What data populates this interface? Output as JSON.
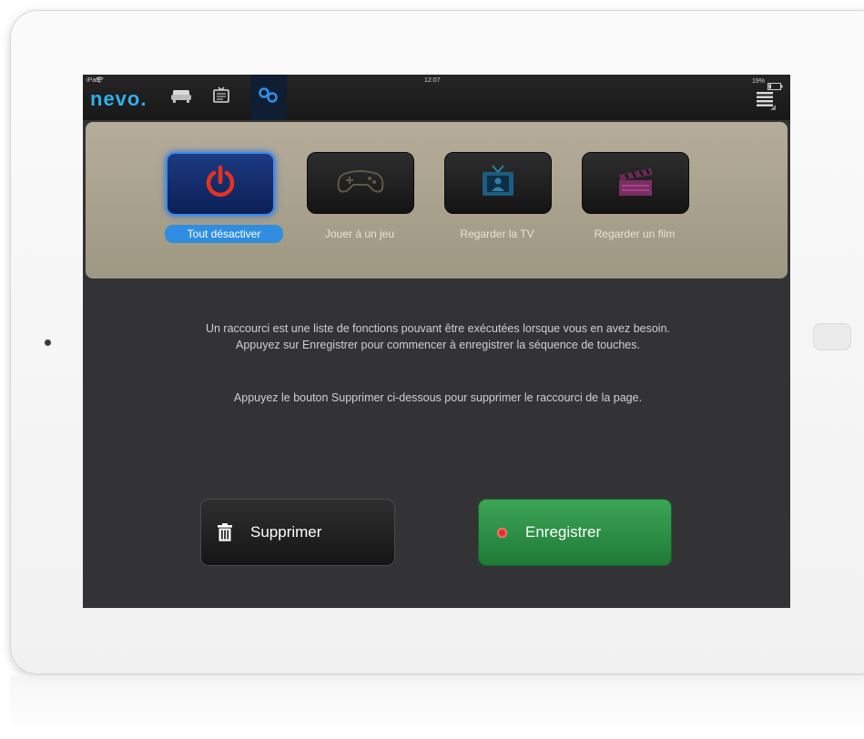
{
  "status_bar": {
    "device": "iPad",
    "time": "12:07",
    "battery": "19%"
  },
  "app": {
    "logo": "nevo."
  },
  "nav": [
    {
      "icon": "sofa-icon",
      "active": false
    },
    {
      "icon": "tv-guide-icon",
      "active": false
    },
    {
      "icon": "shortcut-icon",
      "active": true
    }
  ],
  "activities": [
    {
      "label": "Tout désactiver",
      "icon": "power-icon",
      "selected": true
    },
    {
      "label": "Jouer à un jeu",
      "icon": "gamepad-icon",
      "selected": false
    },
    {
      "label": "Regarder la TV",
      "icon": "tv-icon",
      "selected": false
    },
    {
      "label": "Regarder un film",
      "icon": "clapperboard-icon",
      "selected": false
    }
  ],
  "message": {
    "line1": "Un raccourci est une liste de fonctions pouvant être exécutées lorsque vous en avez besoin. Appuyez sur Enregistrer pour commencer à enregistrer la séquence de touches.",
    "line2": "Appuyez le bouton Supprimer ci-dessous pour supprimer le raccourci de la page."
  },
  "buttons": {
    "delete": "Supprimer",
    "record": "Enregistrer"
  },
  "colors": {
    "accent": "#2f8ee0",
    "record": "#2e8f47",
    "power": "#e8321e",
    "logo": "#33aee8"
  }
}
